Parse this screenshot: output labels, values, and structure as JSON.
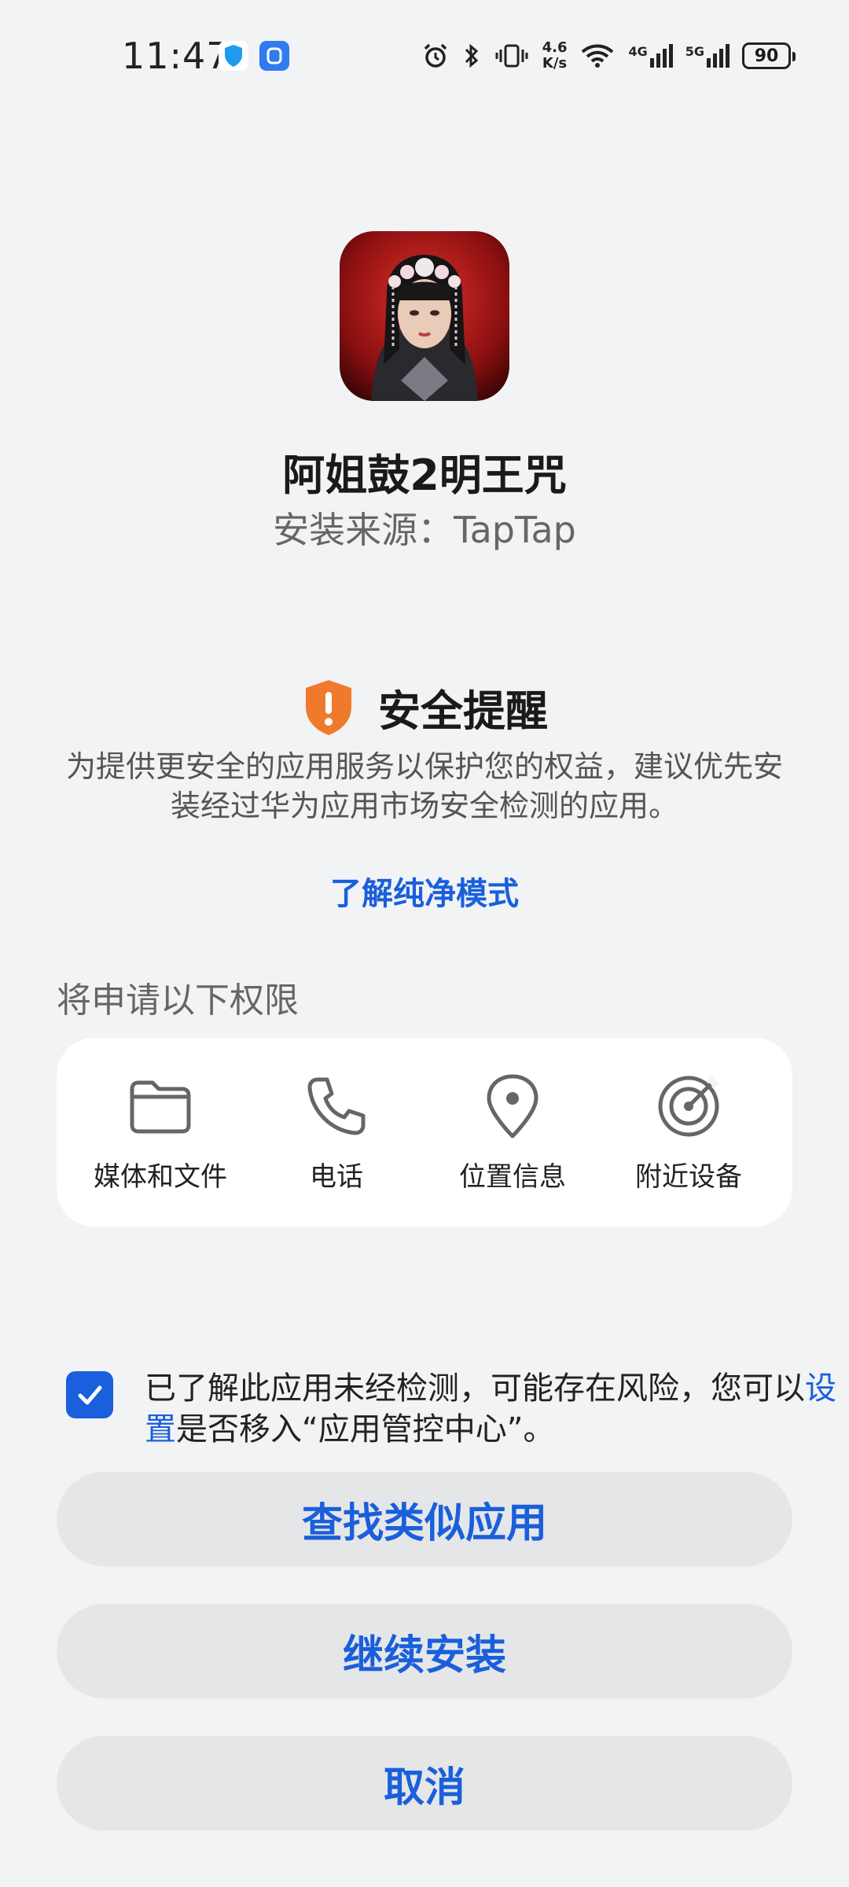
{
  "status_bar": {
    "time": "11:47",
    "speed_value": "4.6",
    "speed_unit": "K/s",
    "net1": "4G",
    "net2": "5G",
    "battery": "90"
  },
  "app": {
    "name": "阿姐鼓2明王咒",
    "source": "安装来源：TapTap"
  },
  "security": {
    "title": "安全提醒",
    "message": "为提供更安全的应用服务以保护您的权益，建议优先安装经过华为应用市场安全检测的应用。",
    "learn_link": "了解纯净模式"
  },
  "permissions": {
    "title": "将申请以下权限",
    "items": [
      {
        "label": "媒体和文件",
        "icon": "folder-icon"
      },
      {
        "label": "电话",
        "icon": "phone-icon"
      },
      {
        "label": "位置信息",
        "icon": "location-pin-icon"
      },
      {
        "label": "附近设备",
        "icon": "radar-icon"
      }
    ]
  },
  "consent": {
    "checked": true,
    "text_before": "已了解此应用未经检测，可能存在风险，您可以",
    "link": "设置",
    "text_after": "是否移入“应用管控中心”。"
  },
  "buttons": {
    "find_similar": "查找类似应用",
    "continue_install": "继续安装",
    "cancel": "取消"
  },
  "colors": {
    "accent": "#1a5fdb",
    "warning": "#f07a2c",
    "background": "#f1f3f5"
  }
}
